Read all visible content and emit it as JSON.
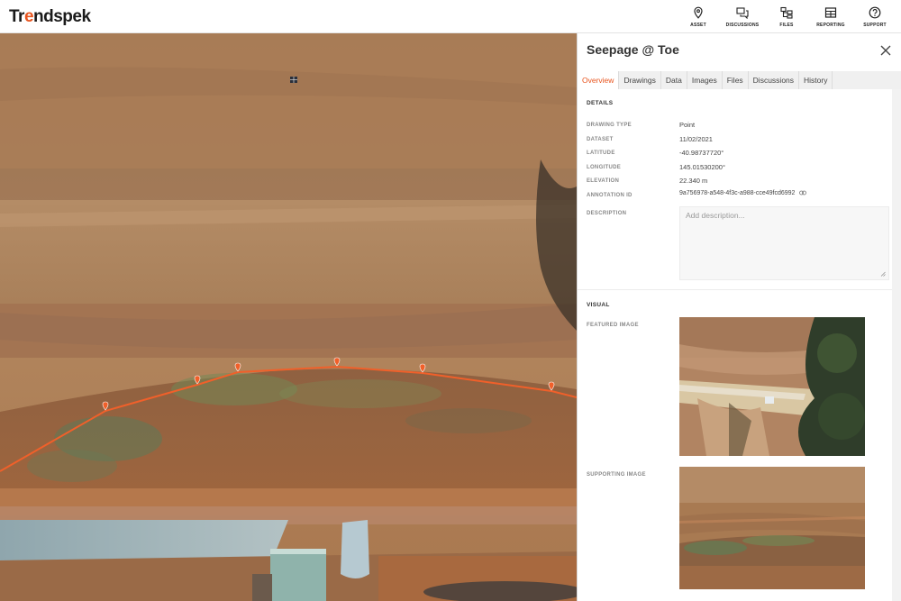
{
  "app": {
    "logo_main": "Tr",
    "logo_accent": "e",
    "logo_rest": "ndspek"
  },
  "nav": {
    "asset": "ASSET",
    "discussions": "DISCUSSIONS",
    "files": "FILES",
    "reporting": "REPORTING",
    "support": "SUPPORT"
  },
  "panel": {
    "title": "Seepage @ Toe",
    "tabs": [
      "Overview",
      "Drawings",
      "Data",
      "Images",
      "Files",
      "Discussions",
      "History"
    ],
    "active_tab": "Overview",
    "details": {
      "heading": "DETAILS",
      "rows": [
        {
          "label": "DRAWING TYPE",
          "value": "Point"
        },
        {
          "label": "DATASET",
          "value": "11/02/2021"
        },
        {
          "label": "LATITUDE",
          "value": "-40.98737720°"
        },
        {
          "label": "LONGITUDE",
          "value": "145.01530200°"
        },
        {
          "label": "ELEVATION",
          "value": "22.340 m"
        },
        {
          "label": "ANNOTATION ID",
          "value": "9a756978-a548-4f3c-a988-cce49fcd6992"
        }
      ],
      "description_label": "DESCRIPTION",
      "description_placeholder": "Add description..."
    },
    "visual": {
      "heading": "VISUAL",
      "featured_label": "FEATURED IMAGE",
      "supporting_label": "SUPPORTING IMAGE"
    }
  },
  "colors": {
    "accent": "#e8541e",
    "marker": "#f0602a"
  }
}
